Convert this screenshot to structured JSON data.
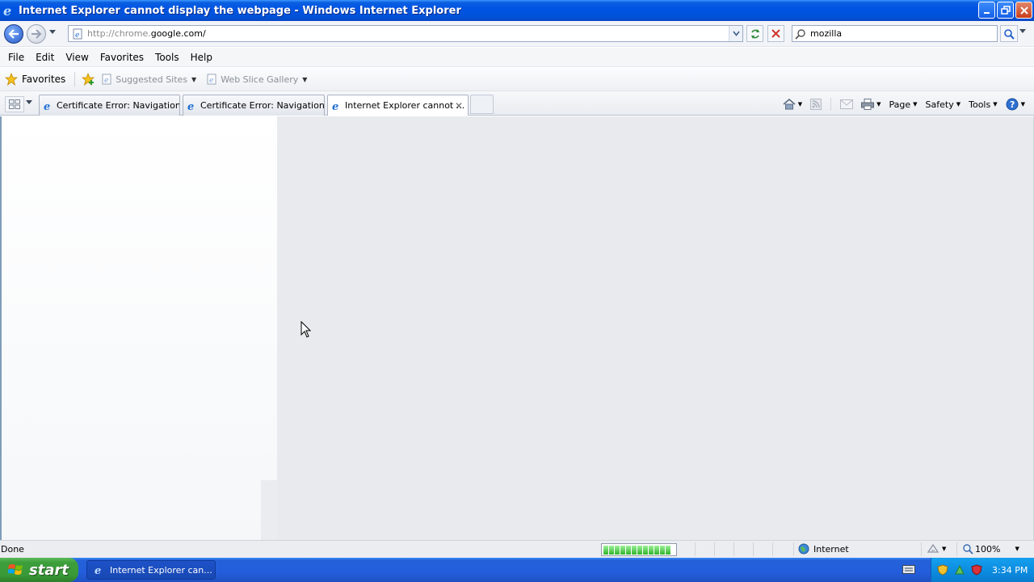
{
  "window": {
    "title": "Internet Explorer cannot display the webpage - Windows Internet Explorer"
  },
  "address_bar": {
    "url_prefix": "http://chrome.",
    "url_host": "google.com/",
    "search_value": "mozilla"
  },
  "menu": [
    "File",
    "Edit",
    "View",
    "Favorites",
    "Tools",
    "Help"
  ],
  "favorites_bar": {
    "favorites_label": "Favorites",
    "links": [
      {
        "label": "Suggested Sites"
      },
      {
        "label": "Web Slice Gallery"
      }
    ]
  },
  "tabs": [
    {
      "label": "Certificate Error: Navigation ..."
    },
    {
      "label": "Certificate Error: Navigation ..."
    },
    {
      "label": "Internet Explorer cannot ...",
      "active": true
    }
  ],
  "command_bar": {
    "page": "Page",
    "safety": "Safety",
    "tools": "Tools"
  },
  "status_bar": {
    "status": "Done",
    "zone": "Internet",
    "zoom": "100%",
    "progress_percent": 100
  },
  "taskbar": {
    "start": "start",
    "task_item": "Internet Explorer can...",
    "clock": "3:34 PM"
  },
  "colors": {
    "titlebar": "#0054e3",
    "start_button": "#3c9e3a",
    "tray": "#0c8ee1"
  }
}
